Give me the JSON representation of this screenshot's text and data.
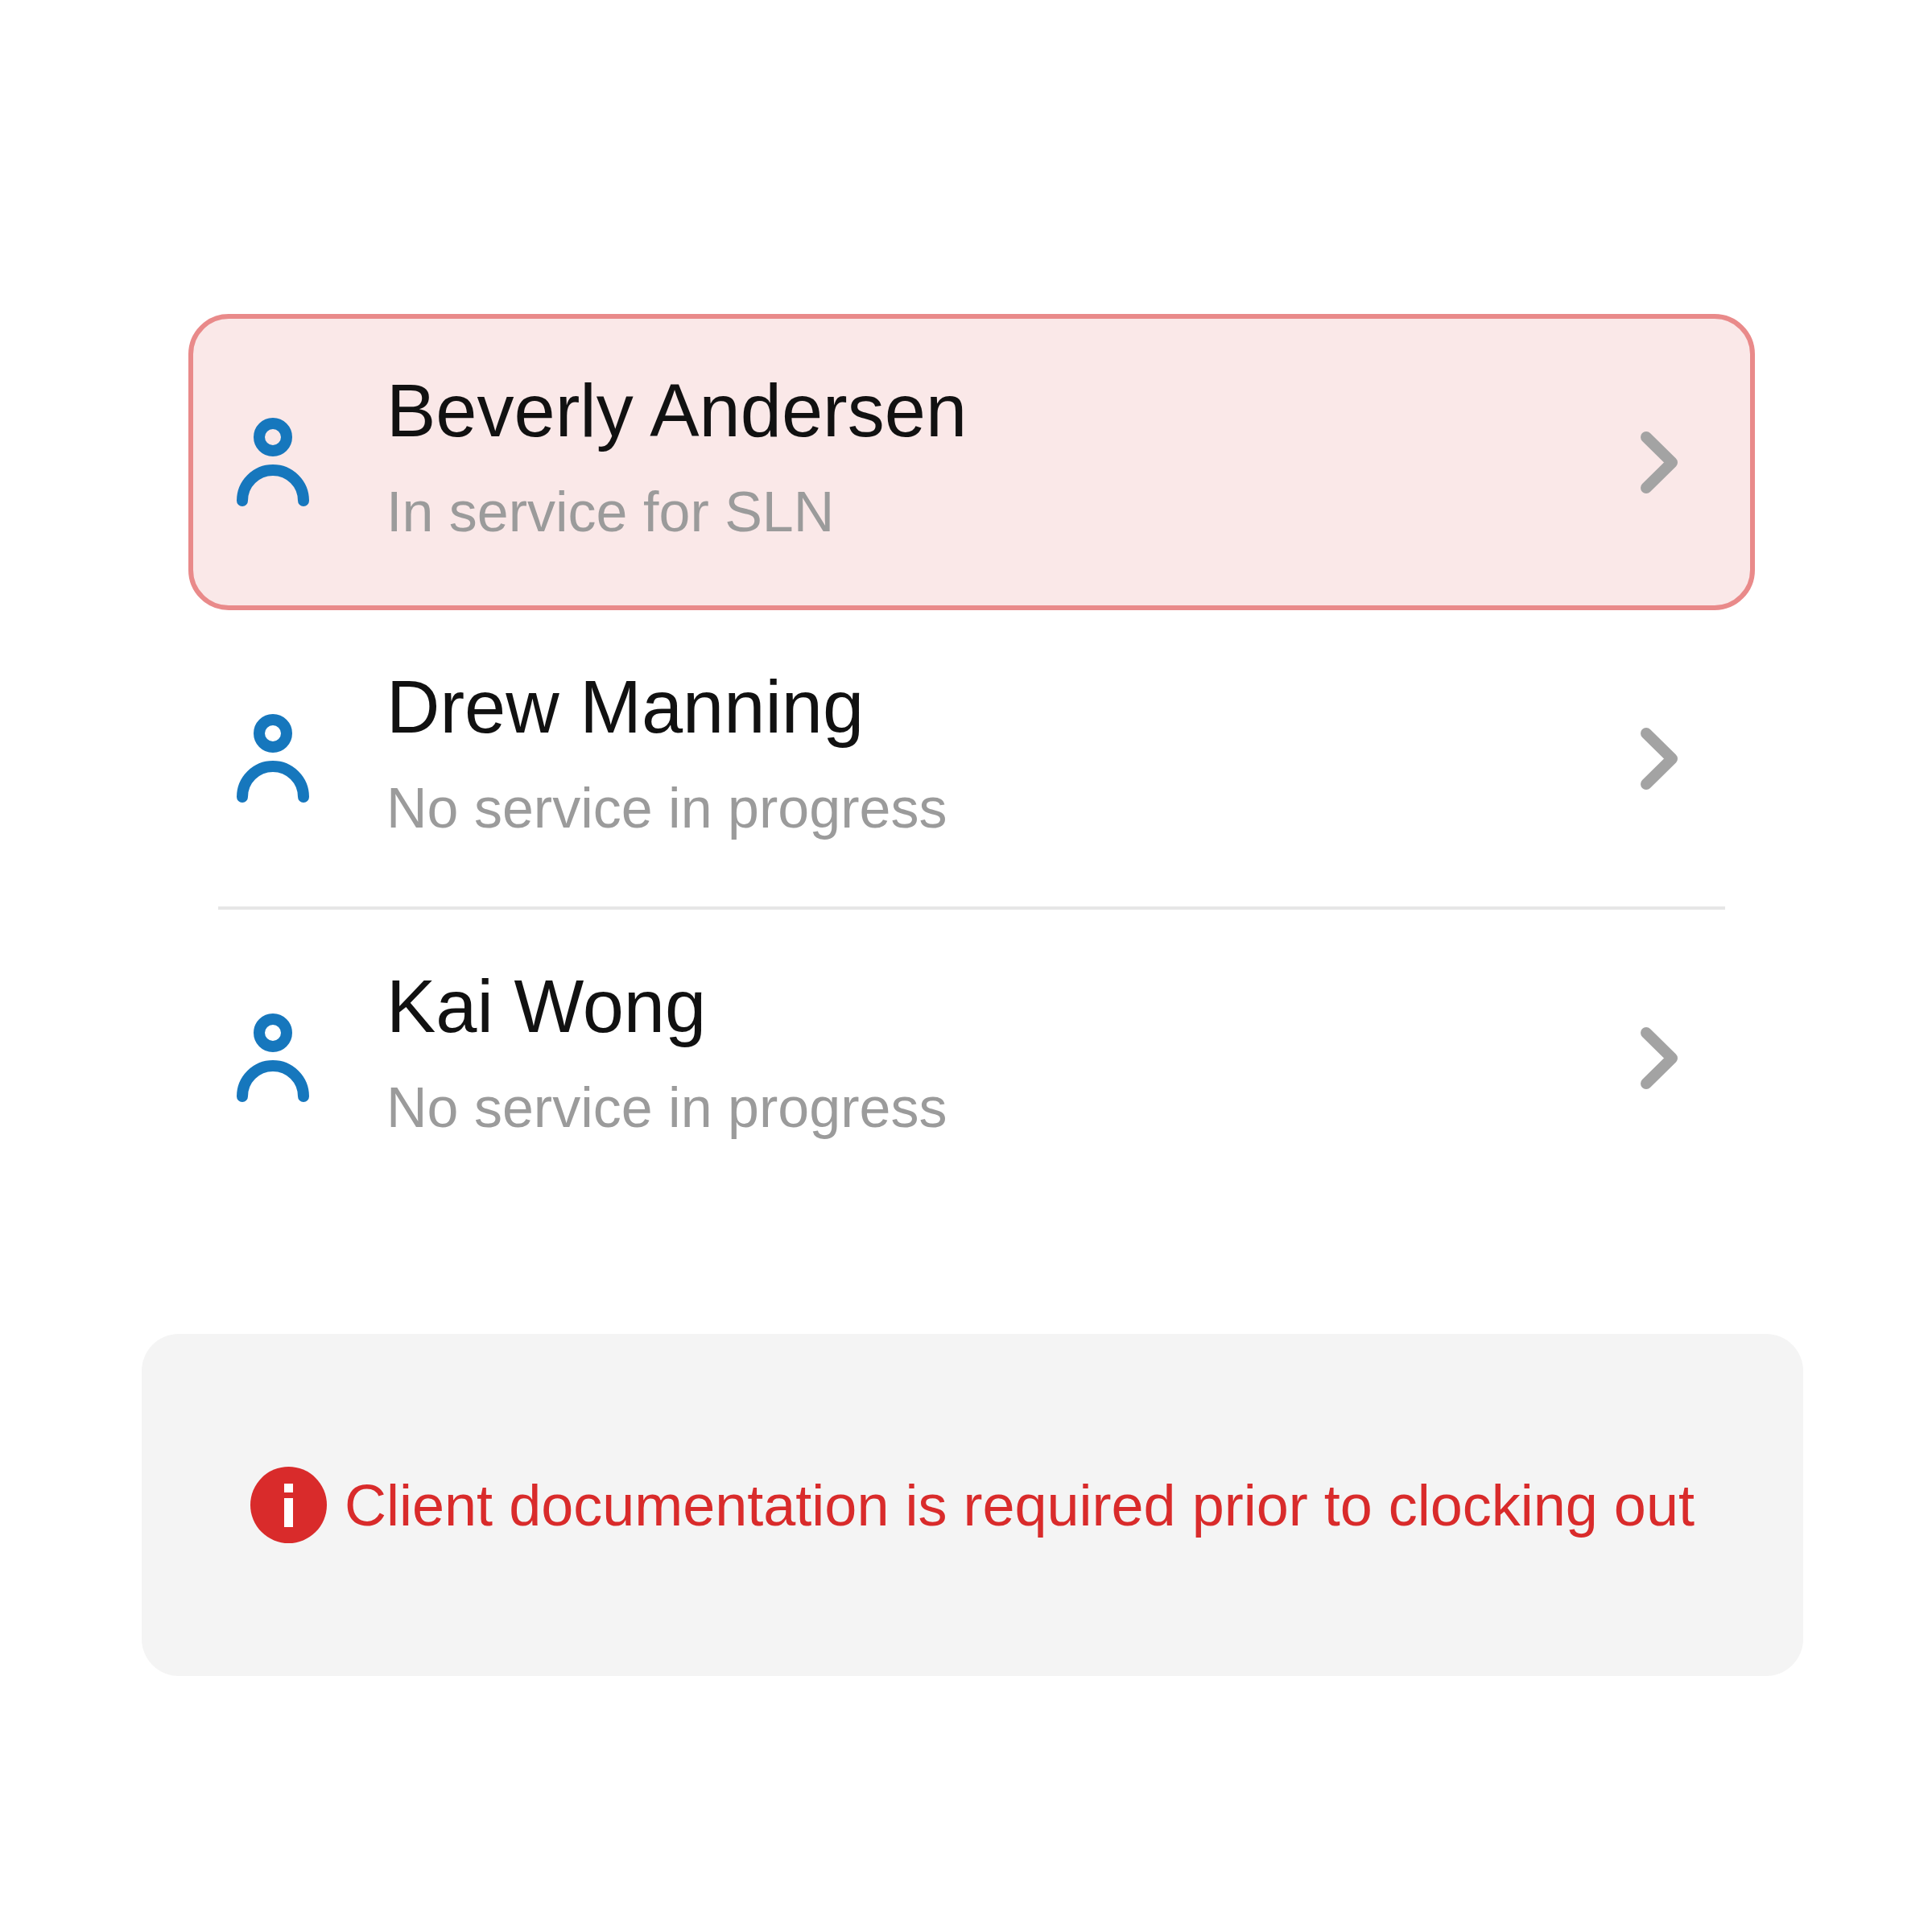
{
  "rows": [
    {
      "name": "Beverly Andersen",
      "status": "In service for SLN",
      "selected": true
    },
    {
      "name": "Drew Manning",
      "status": "No service in progress",
      "selected": false
    },
    {
      "name": "Kai Wong",
      "status": "No service in progress",
      "selected": false
    }
  ],
  "notice": {
    "text": "Client documentation is required prior to clocking out"
  }
}
